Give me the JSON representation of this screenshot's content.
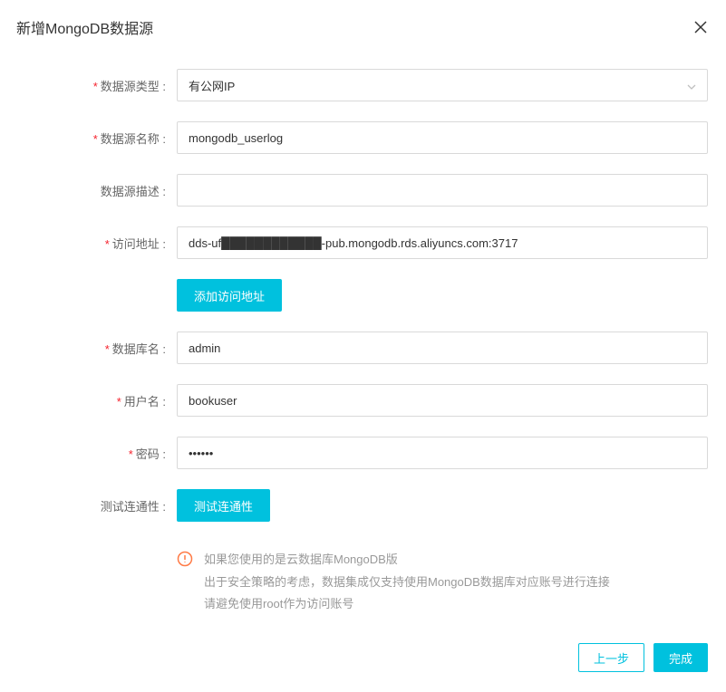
{
  "modal": {
    "title": "新增MongoDB数据源"
  },
  "form": {
    "type": {
      "label": "数据源类型",
      "value": "有公网IP"
    },
    "name": {
      "label": "数据源名称",
      "value": "mongodb_userlog"
    },
    "desc": {
      "label": "数据源描述",
      "value": ""
    },
    "addr": {
      "label": "访问地址",
      "value": "dds-uf████████████-pub.mongodb.rds.aliyuncs.com:3717"
    },
    "addAddr": {
      "label": "添加访问地址"
    },
    "db": {
      "label": "数据库名",
      "value": "admin"
    },
    "user": {
      "label": "用户名",
      "value": "bookuser"
    },
    "pwd": {
      "label": "密码",
      "value": "••••••"
    },
    "test": {
      "label": "测试连通性",
      "button": "测试连通性"
    }
  },
  "info": {
    "line1": "如果您使用的是云数据库MongoDB版",
    "line2": "出于安全策略的考虑，数据集成仅支持使用MongoDB数据库对应账号进行连接",
    "line3": "请避免使用root作为访问账号"
  },
  "footer": {
    "prev": "上一步",
    "done": "完成"
  }
}
